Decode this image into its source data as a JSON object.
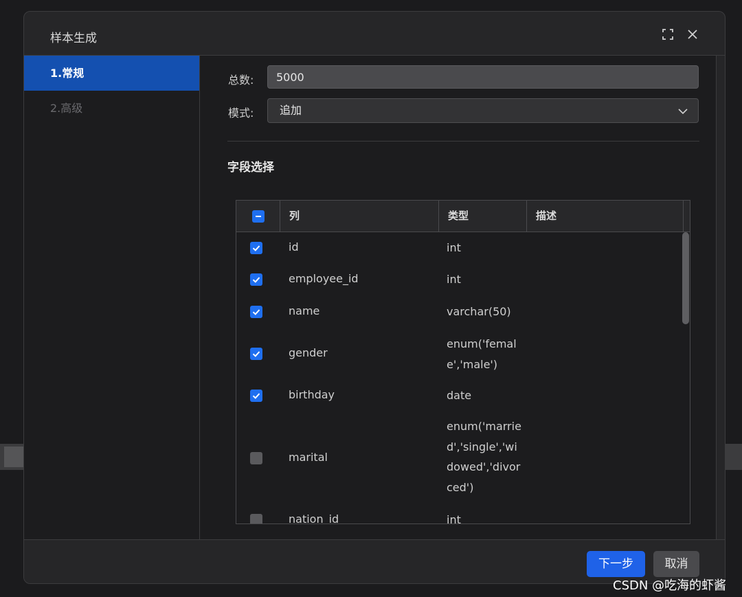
{
  "dialog": {
    "title": "样本生成",
    "maximize_icon": "maximize-icon",
    "close_icon": "close-icon"
  },
  "steps": [
    {
      "label": "1.常规",
      "active": true
    },
    {
      "label": "2.高级",
      "active": false
    }
  ],
  "form": {
    "total_label": "总数:",
    "total_value": "5000",
    "mode_label": "模式:",
    "mode_value": "追加"
  },
  "fields": {
    "section_title": "字段选择",
    "header_checkbox_state": "indeterminate",
    "columns": [
      "列",
      "类型",
      "描述"
    ],
    "rows": [
      {
        "name": "id",
        "type": "int",
        "description": "",
        "checked": true
      },
      {
        "name": "employee_id",
        "type": "int",
        "description": "",
        "checked": true
      },
      {
        "name": "name",
        "type": "varchar(50)",
        "description": "",
        "checked": true
      },
      {
        "name": "gender",
        "type": "enum('female','male')",
        "description": "",
        "checked": true
      },
      {
        "name": "birthday",
        "type": "date",
        "description": "",
        "checked": true
      },
      {
        "name": "marital",
        "type": "enum('married','single','widowed','divorced')",
        "description": "",
        "checked": false
      },
      {
        "name": "nation_id",
        "type": "int",
        "description": "",
        "checked": false
      }
    ]
  },
  "footer": {
    "next_label": "下一步",
    "cancel_label": "取消"
  },
  "watermark": "CSDN @吃海的虾酱",
  "colors": {
    "accent": "#1f62e8",
    "active_step": "#1450b0",
    "checkbox_on": "#1f6ff0",
    "checkbox_off": "#5a5a5d"
  }
}
